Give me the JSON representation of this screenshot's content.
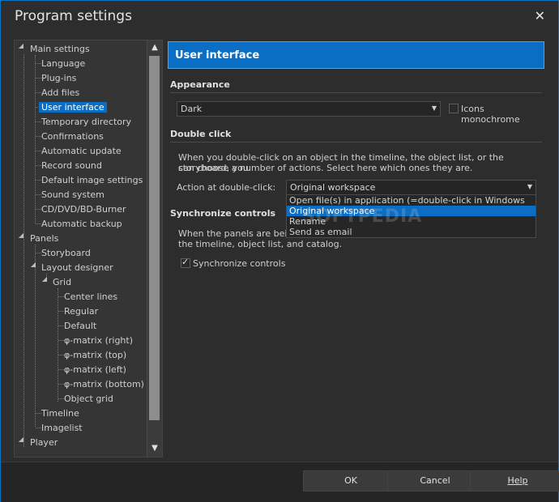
{
  "window": {
    "title": "Program settings",
    "close_icon": "close-icon"
  },
  "tree": {
    "items": [
      {
        "label": "Main settings"
      },
      {
        "label": "Language"
      },
      {
        "label": "Plug-ins"
      },
      {
        "label": "Add files"
      },
      {
        "label": "User interface"
      },
      {
        "label": "Temporary directory"
      },
      {
        "label": "Confirmations"
      },
      {
        "label": "Automatic update"
      },
      {
        "label": "Record sound"
      },
      {
        "label": "Default image settings"
      },
      {
        "label": "Sound system"
      },
      {
        "label": "CD/DVD/BD-Burner"
      },
      {
        "label": "Automatic backup"
      },
      {
        "label": "Panels"
      },
      {
        "label": "Storyboard"
      },
      {
        "label": "Layout designer"
      },
      {
        "label": "Grid"
      },
      {
        "label": "Center lines"
      },
      {
        "label": "Regular"
      },
      {
        "label": "Default"
      },
      {
        "label": "φ-matrix (right)"
      },
      {
        "label": "φ-matrix (top)"
      },
      {
        "label": "φ-matrix (left)"
      },
      {
        "label": "φ-matrix (bottom)"
      },
      {
        "label": "Object grid"
      },
      {
        "label": "Timeline"
      },
      {
        "label": "Imagelist"
      },
      {
        "label": "Player"
      }
    ],
    "selected": "User interface"
  },
  "panel": {
    "title": "User interface",
    "appearance": {
      "heading": "Appearance",
      "theme_value": "Dark",
      "icons_monochrome_label": "Icons monochrome",
      "icons_monochrome_checked": false
    },
    "double_click": {
      "heading": "Double click",
      "description_line1": "When you double-click on an object in the timeline, the object list, or the storyboard, you",
      "description_line2": "can choose a number of actions. Select here which ones they are.",
      "action_label": "Action at double-click:",
      "action_value": "Original workspace",
      "options": [
        "Open file(s) in application (=double-click in Windows Explorer)",
        "Original workspace",
        "Rename",
        "Send as email"
      ],
      "highlighted_option": "Original workspace"
    },
    "sync": {
      "heading": "Synchronize controls",
      "description_line1": "When the panels are being s",
      "description_line2": "the timeline, object list, and catalog.",
      "checkbox_label": "Synchronize controls",
      "checked": true
    }
  },
  "watermark": "SOFTPEDIA",
  "footer": {
    "ok": "OK",
    "cancel": "Cancel",
    "help": "Help"
  },
  "colors": {
    "accent": "#0a6ec4",
    "background": "#2d2d2d"
  }
}
